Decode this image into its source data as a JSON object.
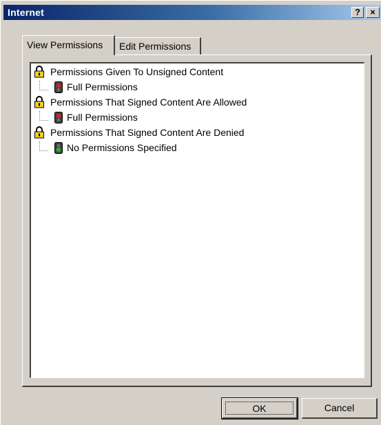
{
  "window": {
    "title": "Internet",
    "help_button": "?",
    "close_button": "×"
  },
  "tabs": [
    {
      "label": "View Permissions",
      "selected": true
    },
    {
      "label": "Edit Permissions",
      "selected": false
    }
  ],
  "tree": [
    {
      "label": "Permissions Given To Unsigned Content",
      "icon": "lock-icon",
      "child": {
        "label": "Full Permissions",
        "icon": "red-light-icon"
      }
    },
    {
      "label": "Permissions That Signed Content Are Allowed",
      "icon": "lock-icon",
      "child": {
        "label": "Full Permissions",
        "icon": "red-light-icon"
      }
    },
    {
      "label": "Permissions That Signed Content Are Denied",
      "icon": "lock-icon",
      "child": {
        "label": "No Permissions Specified",
        "icon": "green-light-icon"
      }
    }
  ],
  "buttons": {
    "ok": "OK",
    "cancel": "Cancel"
  },
  "colors": {
    "titlebar_start": "#0a246a",
    "titlebar_end": "#a6caf0",
    "face": "#d4d0c8",
    "red_light": "#d42020",
    "green_light": "#20b030"
  }
}
